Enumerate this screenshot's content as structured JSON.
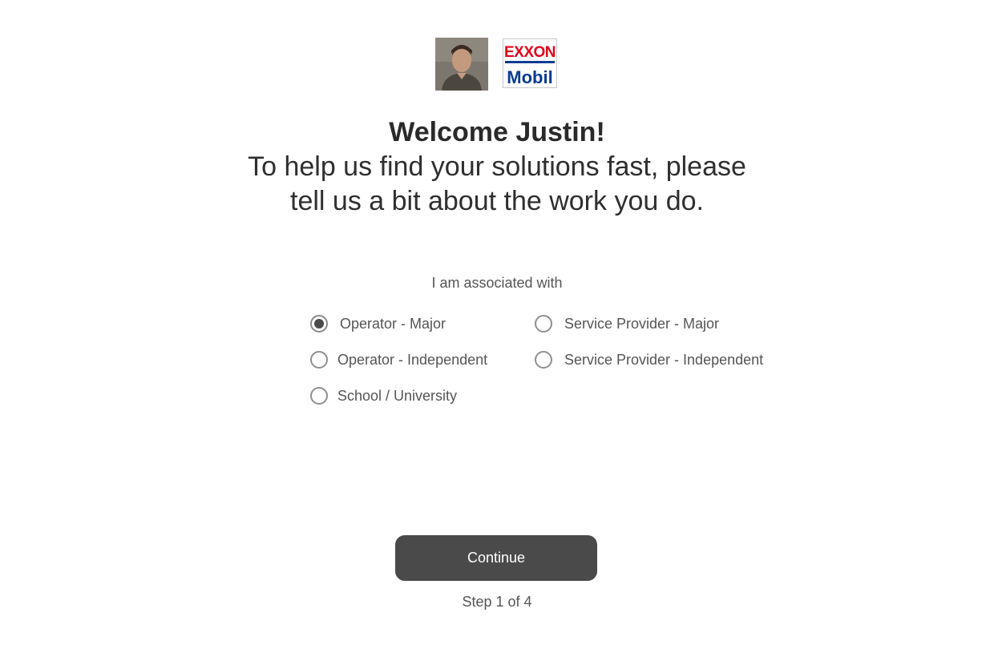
{
  "header": {
    "avatar_alt": "profile photo",
    "logo": {
      "line1": "EXXON",
      "line2": "Mobil",
      "colors": {
        "red": "#e3001b",
        "blue": "#0a3b93"
      }
    }
  },
  "welcome": {
    "title": "Welcome Justin!",
    "subtitle": "To help us find your solutions fast, please tell us a bit about the work you do."
  },
  "form": {
    "question": "I am associated with",
    "selected": "Operator - Major",
    "options": [
      {
        "label": "Operator - Major",
        "checked": true
      },
      {
        "label": "Operator - Independent",
        "checked": false
      },
      {
        "label": "School / University",
        "checked": false
      },
      {
        "label": "Service Provider - Major",
        "checked": false
      },
      {
        "label": "Service Provider - Independent",
        "checked": false
      }
    ]
  },
  "footer": {
    "continue_label": "Continue",
    "step_text": "Step 1 of 4"
  },
  "colors": {
    "button_bg": "#4a4a4a",
    "text": "#555555",
    "heading": "#2a2a2a"
  }
}
